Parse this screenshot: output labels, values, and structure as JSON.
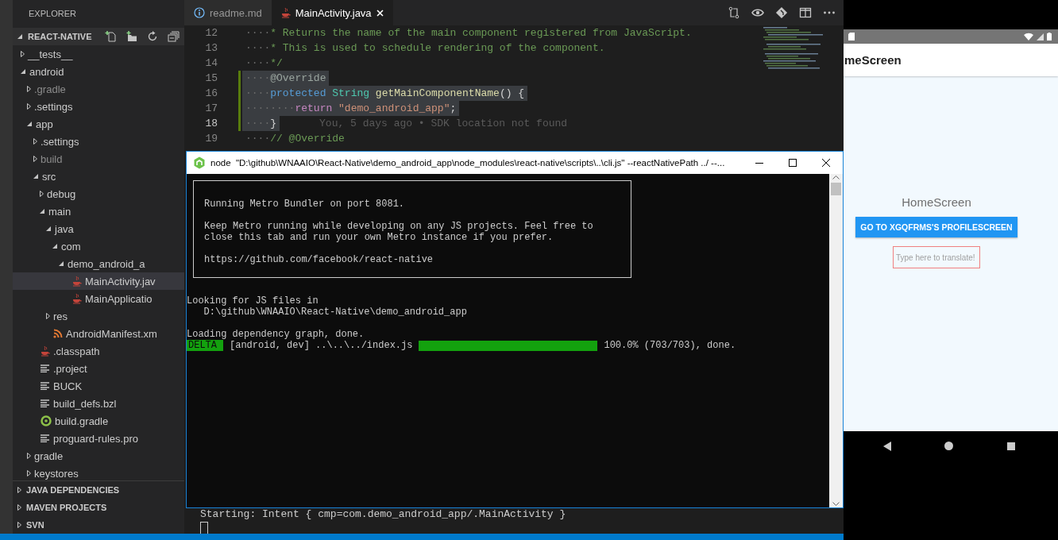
{
  "sidebar": {
    "title": "EXPLORER",
    "section": {
      "label": "REACT-NATIVE",
      "expanded": true
    },
    "items": [
      {
        "name": "__tests__",
        "kind": "folder",
        "expanded": false,
        "selected": false,
        "ignored": false
      },
      {
        "name": "android",
        "kind": "folder",
        "expanded": true,
        "selected": false,
        "ignored": false,
        "children": [
          {
            "name": ".gradle",
            "kind": "folder",
            "expanded": false,
            "selected": false,
            "ignored": true
          },
          {
            "name": ".settings",
            "kind": "folder",
            "expanded": false,
            "selected": false,
            "ignored": false
          },
          {
            "name": "app",
            "kind": "folder",
            "expanded": true,
            "selected": false,
            "ignored": false,
            "children": [
              {
                "name": ".settings",
                "kind": "folder",
                "expanded": false,
                "selected": false,
                "ignored": false
              },
              {
                "name": "build",
                "kind": "folder",
                "expanded": false,
                "selected": false,
                "ignored": true
              },
              {
                "name": "src",
                "kind": "folder",
                "expanded": true,
                "selected": false,
                "ignored": false,
                "children": [
                  {
                    "name": "debug",
                    "kind": "folder",
                    "expanded": false,
                    "selected": false,
                    "ignored": false
                  },
                  {
                    "name": "main",
                    "kind": "folder",
                    "expanded": true,
                    "selected": false,
                    "ignored": false,
                    "children": [
                      {
                        "name": "java",
                        "kind": "folder",
                        "expanded": true,
                        "selected": false,
                        "ignored": false,
                        "children": [
                          {
                            "name": "com",
                            "kind": "folder",
                            "expanded": true,
                            "selected": false,
                            "ignored": false,
                            "children": [
                              {
                                "name": "demo_android_a",
                                "kind": "folder",
                                "expanded": true,
                                "selected": false,
                                "ignored": false,
                                "children": [
                                  {
                                    "name": "MainActivity.jav",
                                    "kind": "java",
                                    "selected": true,
                                    "ignored": false
                                  },
                                  {
                                    "name": "MainApplicatio",
                                    "kind": "java",
                                    "selected": false,
                                    "ignored": false
                                  }
                                ]
                              }
                            ]
                          }
                        ]
                      },
                      {
                        "name": "res",
                        "kind": "folder",
                        "expanded": false,
                        "selected": false,
                        "ignored": false
                      },
                      {
                        "name": "AndroidManifest.xm",
                        "kind": "xml",
                        "selected": false,
                        "ignored": false
                      }
                    ]
                  }
                ]
              },
              {
                "name": ".classpath",
                "kind": "java",
                "selected": false,
                "ignored": false
              },
              {
                "name": ".project",
                "kind": "text",
                "selected": false,
                "ignored": false
              },
              {
                "name": "BUCK",
                "kind": "text",
                "selected": false,
                "ignored": false
              },
              {
                "name": "build_defs.bzl",
                "kind": "text",
                "selected": false,
                "ignored": false
              },
              {
                "name": "build.gradle",
                "kind": "gradle",
                "selected": false,
                "ignored": false
              },
              {
                "name": "proguard-rules.pro",
                "kind": "text",
                "selected": false,
                "ignored": false
              }
            ]
          },
          {
            "name": "gradle",
            "kind": "folder",
            "expanded": false,
            "selected": false,
            "ignored": false
          },
          {
            "name": "keystores",
            "kind": "folder",
            "expanded": false,
            "selected": false,
            "ignored": false
          }
        ]
      }
    ],
    "sections": [
      {
        "label": "JAVA DEPENDENCIES",
        "expanded": false
      },
      {
        "label": "MAVEN PROJECTS",
        "expanded": false
      },
      {
        "label": "SVN",
        "expanded": false
      }
    ]
  },
  "editor": {
    "tabs": [
      {
        "label": "readme.md",
        "kind": "info",
        "selected": false
      },
      {
        "label": "MainActivity.java",
        "kind": "java",
        "selected": true
      }
    ],
    "lines": [
      {
        "number": "12",
        "indent": "····",
        "tokens": [
          {
            "kind": "comment",
            "text": "* Returns the name of the main component registered from JavaScript."
          }
        ],
        "highlighted": false,
        "modified": false,
        "current": false
      },
      {
        "number": "13",
        "indent": "····",
        "tokens": [
          {
            "kind": "comment",
            "text": "* This is used to schedule rendering of the component."
          }
        ],
        "highlighted": false,
        "modified": false,
        "current": false
      },
      {
        "number": "14",
        "indent": "····",
        "tokens": [
          {
            "kind": "comment",
            "text": "*/"
          }
        ],
        "highlighted": false,
        "modified": false,
        "current": false
      },
      {
        "number": "15",
        "indent": "····",
        "tokens": [
          {
            "kind": "annotation",
            "text": "@Override"
          }
        ],
        "highlighted": true,
        "modified": true,
        "current": false
      },
      {
        "number": "16",
        "indent": "····",
        "tokens": [
          {
            "kind": "keyword",
            "text": "protected"
          },
          {
            "kind": "type",
            "text": " String"
          },
          {
            "kind": "function",
            "text": " getMainComponentName"
          },
          {
            "kind": "plain",
            "text": "() {"
          }
        ],
        "highlighted": true,
        "modified": true,
        "current": false
      },
      {
        "number": "17",
        "indent": "········",
        "tokens": [
          {
            "kind": "control",
            "text": "return"
          },
          {
            "kind": "string",
            "text": " \"demo_android_app\""
          },
          {
            "kind": "plain",
            "text": ";"
          }
        ],
        "highlighted": true,
        "modified": true,
        "current": false
      },
      {
        "number": "18",
        "indent": "····",
        "tokens": [
          {
            "kind": "plain",
            "text": "}"
          }
        ],
        "highlighted": true,
        "modified": true,
        "current": true,
        "blame": "You, 5 days ago • SDK location not found"
      },
      {
        "number": "19",
        "indent": "····",
        "tokens": [
          {
            "kind": "comment",
            "text": "// @Override"
          }
        ],
        "highlighted": false,
        "modified": false,
        "current": false
      }
    ]
  },
  "terminal_panel": {
    "lines": [
      "Starting: Intent { cmp=com.demo_android_app/.MainActivity }"
    ]
  },
  "console_window": {
    "title": "node  \"D:\\github\\WNAAIO\\React-Native\\demo_android_app\\node_modules\\react-native\\scripts\\..\\cli.js\" --reactNativePath ../ --...",
    "banner": [
      "Running Metro Bundler on port 8081.",
      "Keep Metro running while developing on any JS projects. Feel free to\nclose this tab and run your own Metro instance if you prefer.",
      "https://github.com/facebook/react-native"
    ],
    "groups": [
      [
        "Looking for JS files in",
        "   D:\\github\\WNAAIO\\React-Native\\demo_android_app"
      ],
      [
        "Loading dependency graph, done."
      ]
    ],
    "progress": {
      "tag": "DELTA",
      "target": "[android, dev] ..\\..\\../index.js",
      "level": 1,
      "reading": "100.0% (703/703), done."
    }
  },
  "emulator": {
    "app_bar_title": "meScreen",
    "heading": "HomeScreen",
    "button": "GO TO XGQFRMS'S PROFILESCREEN",
    "input": {
      "placeholder": "Type here to translate!"
    }
  }
}
